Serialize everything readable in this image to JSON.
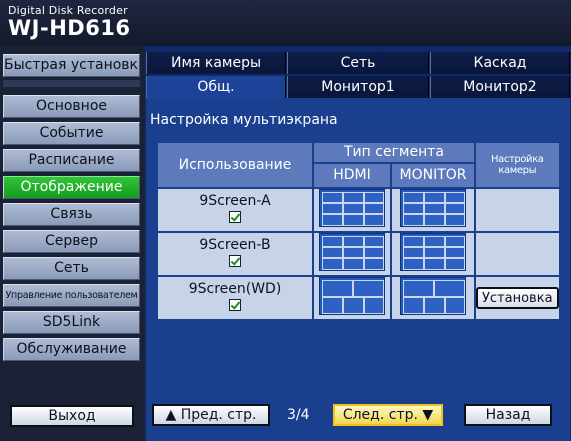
{
  "header": {
    "subtitle": "Digital Disk Recorder",
    "model": "WJ-HD616"
  },
  "sidebar": {
    "quick_setup": "Быстрая установка",
    "items": [
      {
        "label": "Основное"
      },
      {
        "label": "Событие"
      },
      {
        "label": "Расписание"
      },
      {
        "label": "Отображение",
        "active": true
      },
      {
        "label": "Связь"
      },
      {
        "label": "Сервер"
      },
      {
        "label": "Сеть"
      },
      {
        "label": "Управление пользователем"
      },
      {
        "label": "SD5Link"
      },
      {
        "label": "Обслуживание"
      }
    ],
    "exit": "Выход"
  },
  "tabs": {
    "row1": [
      "Имя камеры",
      "Сеть",
      "Каскад"
    ],
    "row2": [
      "Общ.",
      "Монитор1",
      "Монитор2"
    ],
    "selected": "Общ."
  },
  "content": {
    "section_title": "Настройка мультиэкрана",
    "table": {
      "headers": {
        "usage": "Использование",
        "segment_type": "Тип сегмента",
        "hdmi": "HDMI",
        "monitor": "MONITOR",
        "camera_setup": "Настройка камеры"
      },
      "rows": [
        {
          "name": "9Screen-A",
          "checked": true
        },
        {
          "name": "9Screen-B",
          "checked": true
        },
        {
          "name": "9Screen(WD)",
          "checked": true,
          "setup_label": "Установка"
        }
      ]
    }
  },
  "footer": {
    "prev": "▲ Пред. стр.",
    "page": "3/4",
    "next": "След. стр. ▼",
    "back": "Назад"
  }
}
